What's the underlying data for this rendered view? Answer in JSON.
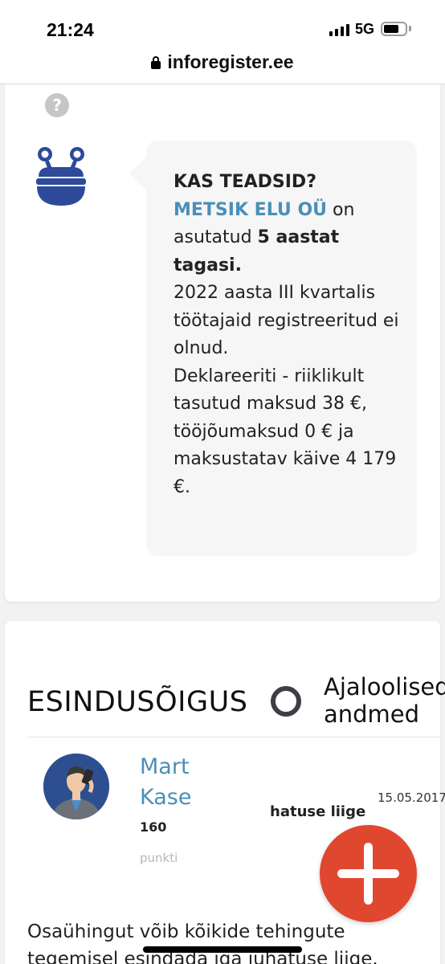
{
  "status_bar": {
    "time": "21:24",
    "network": "5G",
    "url": "inforegister.ee"
  },
  "info_card": {
    "help_symbol": "?",
    "bubble": {
      "heading": "KAS TEADSID?",
      "company": "METSIK ELU OÜ",
      "on_word": " on",
      "founded_prefix": "asutatud ",
      "founded_bold": "5 aastat tagasi.",
      "employees_text": "2022 aasta III kvartalis töötajaid registreeritud ei olnud.",
      "taxes_text": "Deklareeriti - riiklikult tasutud maksud 38 €, tööjõumaksud 0 € ja maksustatav käive 4 179 €."
    }
  },
  "representation": {
    "title": "ESINDUSÕIGUS",
    "history_label_line1": "Ajaloolised",
    "history_label_line2": "andmed",
    "person": {
      "name_first": "Mart",
      "name_last": "Kase",
      "role": "hatuse liige",
      "date": "15.05.2017",
      "points_value": "160",
      "points_label": "punkti"
    },
    "description": "Osaühingut võib kõikide tehingute tegemisel esindada iga juhatuse liige."
  },
  "colors": {
    "link_blue": "#4a8fb8",
    "robot_blue": "#2d4a9b",
    "fab_red": "#e0472f"
  },
  "icons": [
    "lock-icon",
    "help-icon",
    "robot-mascot-icon",
    "toggle-circle-icon",
    "plus-icon"
  ]
}
